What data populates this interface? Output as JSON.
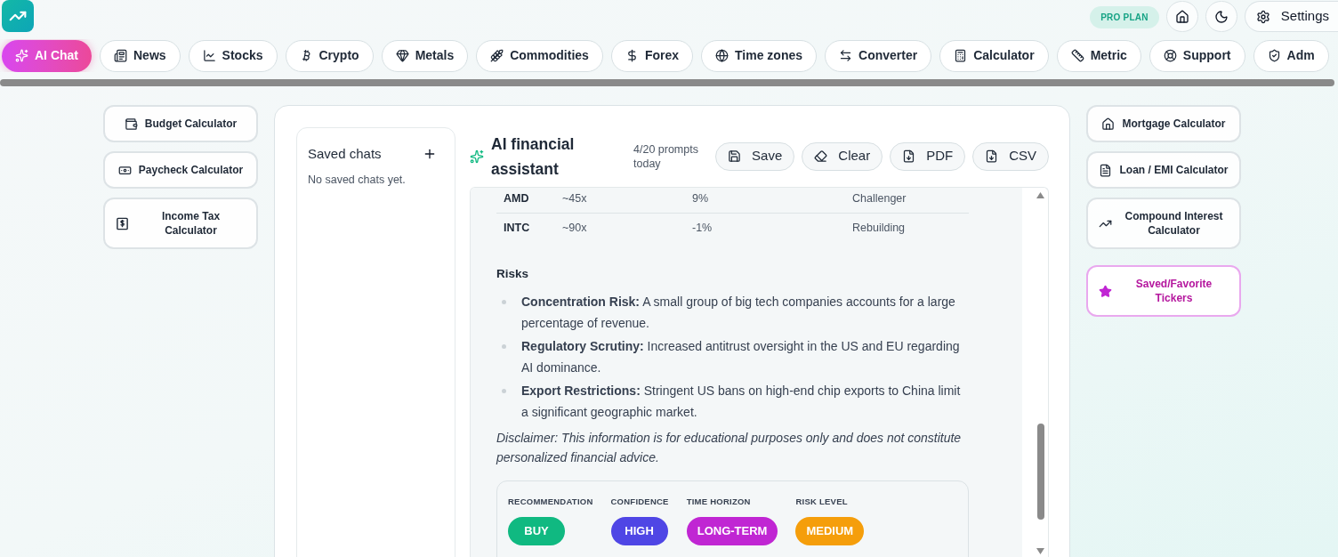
{
  "header": {
    "plan_badge": "PRO PLAN",
    "settings_label": "Settings"
  },
  "nav_tabs": [
    {
      "label": "AI Chat",
      "selected": true
    },
    {
      "label": "News",
      "selected": false
    },
    {
      "label": "Stocks",
      "selected": false
    },
    {
      "label": "Crypto",
      "selected": false
    },
    {
      "label": "Metals",
      "selected": false
    },
    {
      "label": "Commodities",
      "selected": false
    },
    {
      "label": "Forex",
      "selected": false
    },
    {
      "label": "Time zones",
      "selected": false
    },
    {
      "label": "Converter",
      "selected": false
    },
    {
      "label": "Calculator",
      "selected": false
    },
    {
      "label": "Metric",
      "selected": false
    },
    {
      "label": "Support",
      "selected": false
    },
    {
      "label": "Adm",
      "selected": false
    }
  ],
  "left_tools": [
    {
      "label": "Budget Calculator",
      "kind": "plain"
    },
    {
      "label": "Paycheck Calculator",
      "kind": "plain"
    },
    {
      "label": "Income Tax Calculator",
      "kind": "tall"
    }
  ],
  "right_tools": [
    {
      "label": "Mortgage Calculator",
      "kind": "plain"
    },
    {
      "label": "Loan / EMI Calculator",
      "kind": "plain"
    },
    {
      "label": "Compound Interest Calculator",
      "kind": "tall"
    },
    {
      "label": "Saved/Favorite Tickers",
      "kind": "highlight"
    }
  ],
  "saved_chats": {
    "title": "Saved chats",
    "empty_text": "No saved chats yet."
  },
  "assistant": {
    "title": "AI financial assistant",
    "usage": "4/20 prompts today",
    "actions": [
      {
        "label": "Save"
      },
      {
        "label": "Clear"
      },
      {
        "label": "PDF"
      },
      {
        "label": "CSV"
      }
    ]
  },
  "message": {
    "table": {
      "rows": [
        [
          "AMD",
          "~45x",
          "9%",
          "Challenger"
        ],
        [
          "INTC",
          "~90x",
          "-1%",
          "Rebuilding"
        ]
      ]
    },
    "risks_heading": "Risks",
    "risks": [
      "**Concentration Risk:** A small group of big tech companies accounts for a large percentage of revenue.",
      "**Regulatory Scrutiny:** Increased antitrust oversight in the US and EU regarding AI dominance.",
      "**Export Restrictions:** Stringent US bans on high-end chip exports to China limit a significant geographic market."
    ],
    "disclaimer": "Disclaimer: This information is for educational purposes only and does not constitute personalized financial advice.",
    "summary": [
      {
        "label": "RECOMMENDATION",
        "value": "BUY",
        "color": "#10b981"
      },
      {
        "label": "CONFIDENCE",
        "value": "HIGH",
        "color": "#4f46e5"
      },
      {
        "label": "TIME HORIZON",
        "value": "LONG-TERM",
        "color": "#c026d3"
      },
      {
        "label": "RISK LEVEL",
        "value": "MEDIUM",
        "color": "#f59e0b"
      }
    ]
  }
}
